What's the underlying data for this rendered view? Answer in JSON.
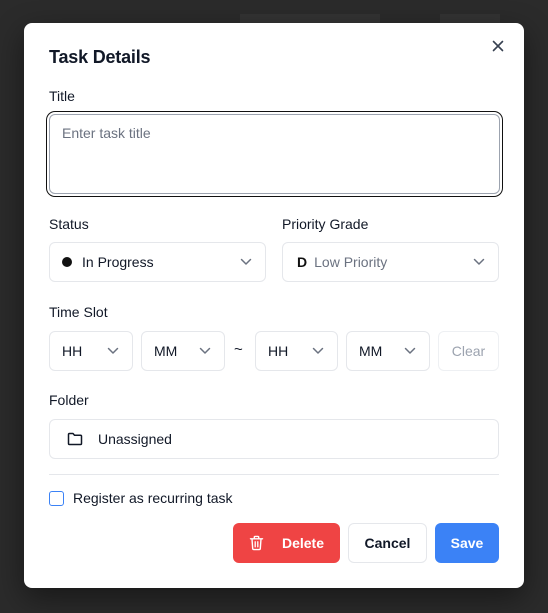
{
  "dialog": {
    "title": "Task Details"
  },
  "fields": {
    "title": {
      "label": "Title",
      "value": "",
      "placeholder": "Enter task title"
    },
    "status": {
      "label": "Status",
      "value": "In Progress"
    },
    "priority": {
      "label": "Priority Grade",
      "grade": "D",
      "value": "Low Priority"
    },
    "time_slot": {
      "label": "Time Slot",
      "start_hour": "HH",
      "start_minute": "MM",
      "separator": "~",
      "end_hour": "HH",
      "end_minute": "MM",
      "clear_label": "Clear"
    },
    "folder": {
      "label": "Folder",
      "value": "Unassigned"
    },
    "recurring": {
      "label": "Register as recurring task",
      "checked": false
    }
  },
  "actions": {
    "delete_label": "Delete",
    "cancel_label": "Cancel",
    "save_label": "Save"
  },
  "icons": {
    "close": "close-icon",
    "chevron": "chevron-down-icon",
    "folder": "folder-icon",
    "trash": "trash-icon"
  },
  "colors": {
    "primary": "#3b82f6",
    "danger": "#ef4444",
    "status_dot": "#111111",
    "overlay": "#2b2b2b"
  }
}
